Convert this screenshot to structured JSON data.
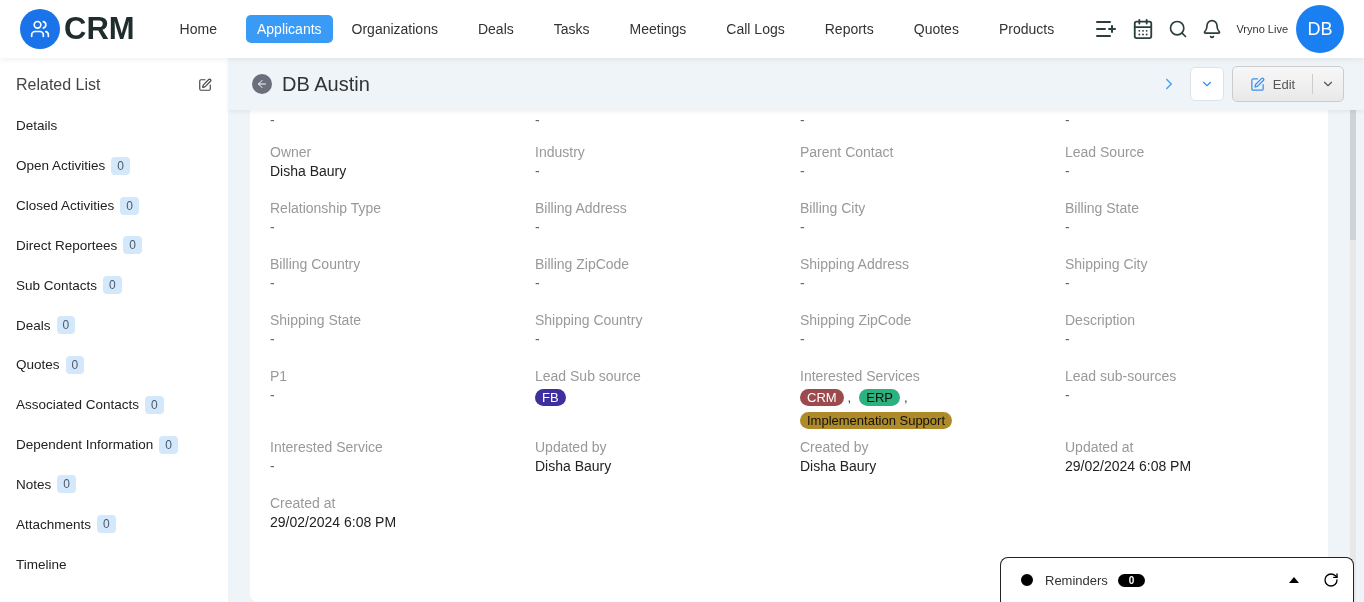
{
  "brand": "CRM",
  "nav": [
    {
      "label": "Home",
      "selected": false
    },
    {
      "label": "Applicants",
      "selected": true
    },
    {
      "label": "Organizations",
      "selected": false
    },
    {
      "label": "Deals",
      "selected": false
    },
    {
      "label": "Tasks",
      "selected": false
    },
    {
      "label": "Meetings",
      "selected": false
    },
    {
      "label": "Call Logs",
      "selected": false
    },
    {
      "label": "Reports",
      "selected": false
    },
    {
      "label": "Quotes",
      "selected": false
    },
    {
      "label": "Products",
      "selected": false
    }
  ],
  "user": {
    "name": "Vryno Live",
    "initials": "DB"
  },
  "sidebar": {
    "title": "Related List",
    "items": [
      {
        "label": "Details"
      },
      {
        "label": "Open Activities",
        "count": "0"
      },
      {
        "label": "Closed Activities",
        "count": "0"
      },
      {
        "label": "Direct Reportees",
        "count": "0"
      },
      {
        "label": "Sub Contacts",
        "count": "0"
      },
      {
        "label": "Deals",
        "count": "0"
      },
      {
        "label": "Quotes",
        "count": "0"
      },
      {
        "label": "Associated Contacts",
        "count": "0"
      },
      {
        "label": "Dependent Information",
        "count": "0"
      },
      {
        "label": "Notes",
        "count": "0"
      },
      {
        "label": "Attachments",
        "count": "0"
      },
      {
        "label": "Timeline"
      }
    ]
  },
  "record": {
    "title": "DB Austin",
    "edit_label": "Edit"
  },
  "partial_values": [
    "-",
    "-",
    "-",
    "-"
  ],
  "fields": [
    {
      "label": "Owner",
      "value": "Disha Baury"
    },
    {
      "label": "Industry",
      "value": "-"
    },
    {
      "label": "Parent Contact",
      "value": "-"
    },
    {
      "label": "Lead Source",
      "value": "-"
    },
    {
      "label": "Relationship Type",
      "value": "-"
    },
    {
      "label": "Billing Address",
      "value": "-"
    },
    {
      "label": "Billing City",
      "value": "-"
    },
    {
      "label": "Billing State",
      "value": "-"
    },
    {
      "label": "Billing Country",
      "value": "-"
    },
    {
      "label": "Billing ZipCode",
      "value": "-"
    },
    {
      "label": "Shipping Address",
      "value": "-"
    },
    {
      "label": "Shipping City",
      "value": "-"
    },
    {
      "label": "Shipping State",
      "value": "-"
    },
    {
      "label": "Shipping Country",
      "value": "-"
    },
    {
      "label": "Shipping ZipCode",
      "value": "-"
    },
    {
      "label": "Description",
      "value": "-"
    },
    {
      "label": "P1",
      "value": "-"
    },
    {
      "label": "Lead Sub source",
      "tags": [
        {
          "text": "FB",
          "color": "#3d2f9e"
        }
      ]
    },
    {
      "label": "Interested Services",
      "tags": [
        {
          "text": "CRM",
          "color": "#9c4a4c",
          "separator": ","
        },
        {
          "text": "ERP",
          "color": "#2bb27e",
          "separator": ","
        },
        {
          "text": "Implementation Support",
          "color": "#ae8a28"
        }
      ]
    },
    {
      "label": "Lead sub-sources",
      "value": "-"
    },
    {
      "label": "Interested Service",
      "value": "-"
    },
    {
      "label": "Updated by",
      "value": "Disha Baury"
    },
    {
      "label": "Created by",
      "value": "Disha Baury"
    },
    {
      "label": "Updated at",
      "value": "29/02/2024 6:08 PM"
    },
    {
      "label": "Created at",
      "value": "29/02/2024 6:08 PM"
    }
  ],
  "reminders": {
    "label": "Reminders",
    "count": "0"
  }
}
